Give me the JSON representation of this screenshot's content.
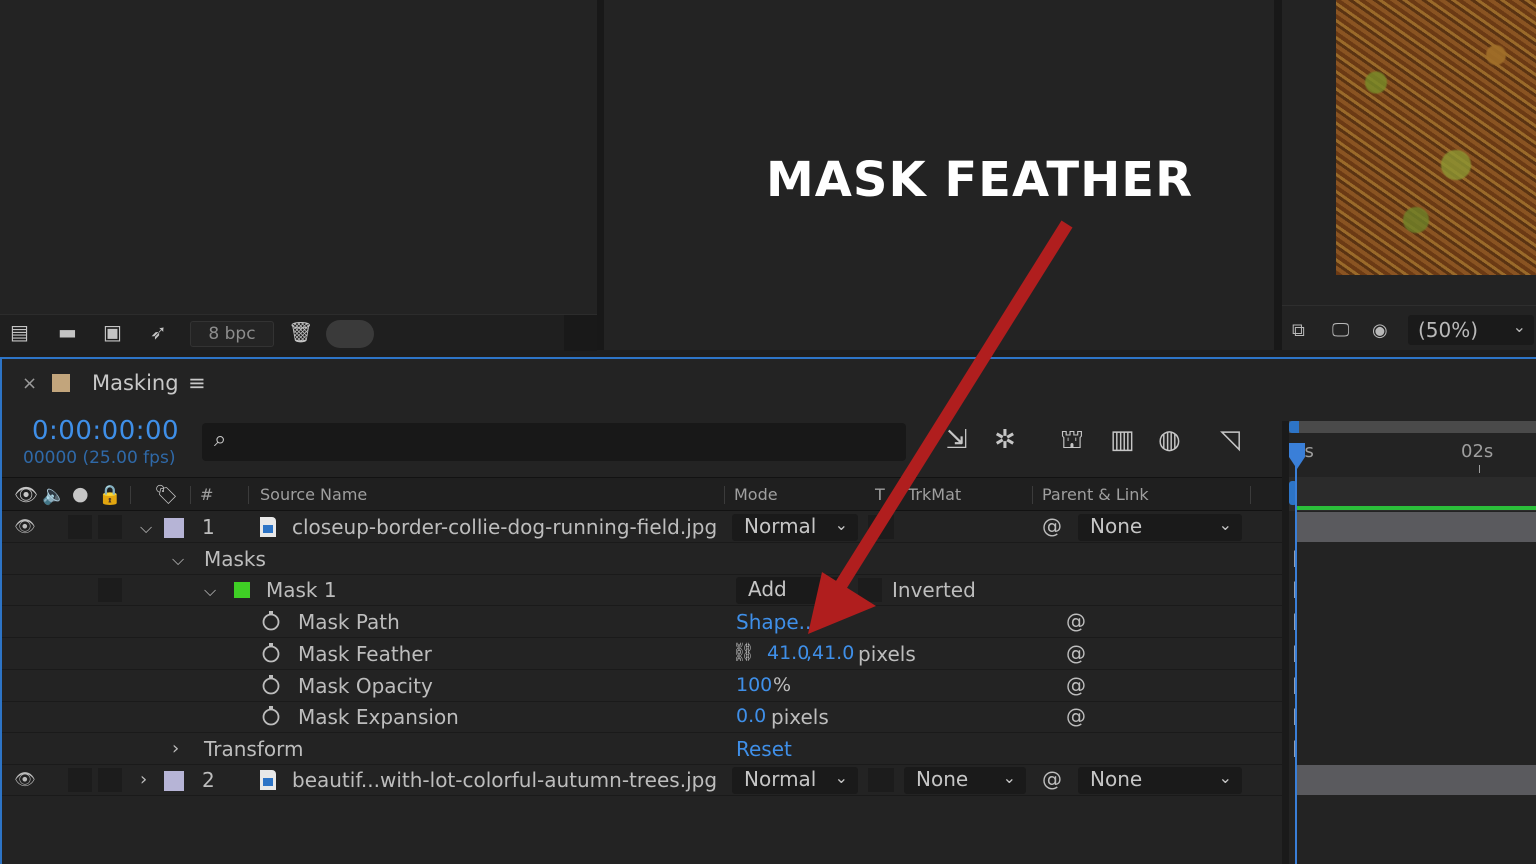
{
  "project_panel": {
    "bpc_label": "8 bpc",
    "footer_icons": [
      "interpret-footage-icon",
      "new-folder-icon",
      "new-composition-icon",
      "render-icon",
      "trash-icon"
    ]
  },
  "preview_panel": {
    "zoom_label": "(50%)"
  },
  "timeline": {
    "tab_title": "Masking",
    "tab_close": "×",
    "tab_menu": "≡",
    "timecode": "0:00:00:00",
    "framecount": "00000 (25.00 fps)",
    "search_placeholder": "",
    "ruler_labels": [
      "0s",
      "02s"
    ],
    "columns": {
      "hash": "#",
      "source_name": "Source Name",
      "mode": "Mode",
      "t": "T",
      "trkmat": "TrkMat",
      "parent": "Parent & Link"
    }
  },
  "layers": [
    {
      "index": "1",
      "name": "closeup-border-collie-dog-running-field.jpg",
      "mode": "Normal",
      "parent": "None",
      "label_color": "#b6b4d6"
    },
    {
      "index": "2",
      "name": "beautif...with-lot-colorful-autumn-trees.jpg",
      "mode": "Normal",
      "trkmat": "None",
      "parent": "None",
      "label_color": "#b6b4d6"
    }
  ],
  "masks_group": {
    "label": "Masks",
    "mask": {
      "name": "Mask 1",
      "color": "#3fcf25",
      "mode": "Add",
      "inverted_label": "Inverted",
      "properties": {
        "path_label": "Mask Path",
        "path_value": "Shape...",
        "feather_label": "Mask Feather",
        "feather_x": "41.0",
        "feather_sep": ",",
        "feather_y": "41.0",
        "feather_unit": "pixels",
        "opacity_label": "Mask Opacity",
        "opacity_value": "100",
        "opacity_unit": "%",
        "expansion_label": "Mask Expansion",
        "expansion_value": "0.0",
        "expansion_unit": "pixels"
      }
    }
  },
  "transform": {
    "label": "Transform",
    "reset_label": "Reset"
  },
  "annotation": {
    "title": "MASK FEATHER",
    "arrow_color": "#b01e1e"
  }
}
